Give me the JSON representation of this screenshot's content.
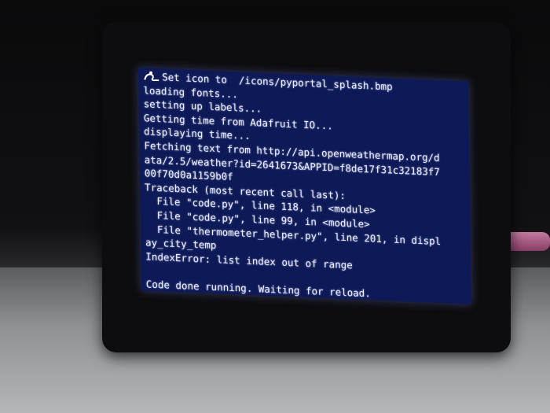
{
  "terminal": {
    "lines": [
      "Set icon to  /icons/pyportal_splash.bmp",
      "loading fonts...",
      "setting up labels...",
      "Getting time from Adafruit IO...",
      "displaying time...",
      "Fetching text from http://api.openweathermap.org/d",
      "ata/2.5/weather?id=2641673&APPID=f8de17f31c32183f7",
      "00f70d0a1159b0f",
      "Traceback (most recent call last):",
      "  File \"code.py\", line 118, in <module>",
      "  File \"code.py\", line 99, in <module>",
      "  File \"thermometer_helper.py\", line 201, in displ",
      "ay_city_temp",
      "IndexError: list index out of range",
      "",
      "Code done running. Waiting for reload."
    ]
  },
  "icons": {
    "splash": "blinka-snake-icon"
  },
  "colors": {
    "screen_bg": "#0e1a57",
    "text": "#eef0ff"
  }
}
